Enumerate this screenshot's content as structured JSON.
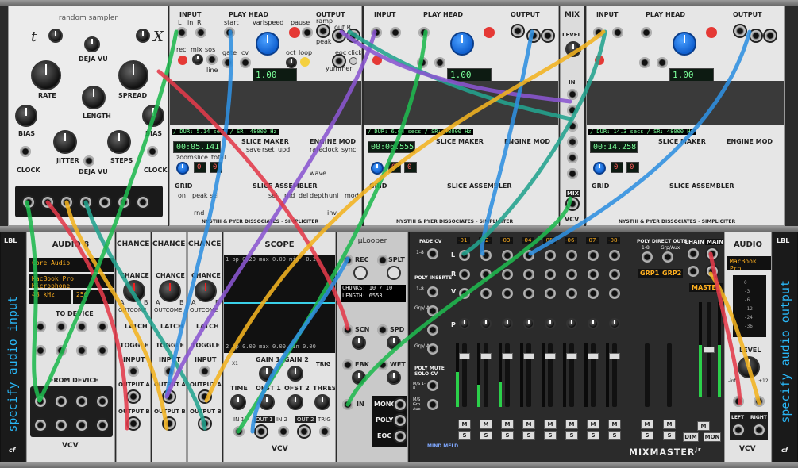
{
  "row1": {
    "sampler": {
      "title": "random sampler",
      "t_label": "t",
      "x_label": "X",
      "knobs": [
        "RATE",
        "SPREAD",
        "LENGTH",
        "BIAS",
        "BIAS",
        "DEJA VU"
      ],
      "labels": [
        "CLOCK",
        "JITTER",
        "DEJA VU",
        "STEPS",
        "CLOCK",
        "DEJA VU"
      ]
    },
    "simpliciter_1": {
      "headers": [
        "INPUT",
        "PLAY HEAD",
        "OUTPUT"
      ],
      "input_labels": [
        "L",
        "in",
        "R"
      ],
      "play_labels": [
        "start",
        "varispeed",
        "pause"
      ],
      "output_labels": [
        "ramp",
        "L out R"
      ],
      "row2": [
        "rec",
        "mix",
        "sos",
        "gate",
        "cv",
        "oct",
        "loop",
        "peak",
        "eoc",
        "click"
      ],
      "row3": [
        "line",
        "yummer"
      ],
      "display": "1.00",
      "dur": "/ DUR: 5.14 secs / SR: 48000 Hz",
      "time": "00:05.141",
      "slice_label": "SLICE MAKER",
      "slice_buttons": [
        "save",
        "rset",
        "upd"
      ],
      "engine_label": "ENGINE MOD",
      "engine_labels": [
        "rate",
        "clock",
        "sync",
        "wave"
      ],
      "zoom_labels": [
        "zoom",
        "slice",
        "total",
        "slice",
        "grid"
      ],
      "zoom_values": [
        "0",
        "0"
      ],
      "grid_label": "GRID",
      "grid_labels": [
        "on",
        "peak",
        "sel",
        "rnd"
      ],
      "assembler_label": "SLICE ASSEMBLER",
      "assembler_labels": [
        "sel",
        "rnd",
        "del",
        "depth",
        "uni",
        "mod",
        "inv"
      ],
      "footer": "NYSTHI & PYER DISSOCIATES - SIMPLICITER"
    },
    "simpliciter_2": {
      "display": "1.00",
      "dur": "/ DUR: 6.64 secs / SR: 48000 Hz",
      "time": "00:06.555",
      "zoom_values": [
        "0",
        "0"
      ],
      "footer": "NYSTHI & PYER DISSOCIATES - SIMPLICITER"
    },
    "mix": {
      "title": "MIX",
      "level": "LEVEL",
      "in": "IN",
      "mix": "MIX",
      "brand": "VCV"
    },
    "simpliciter_3": {
      "display": "1.00",
      "dur": "/ DUR: 14.3 secs / SR: 48000 Hz",
      "time": "00:14.258",
      "zoom_values": [
        "0",
        "0"
      ],
      "footer": "NYSTHI & PYER DISSOCIATES - SIMPLICITER"
    }
  },
  "row2": {
    "lbl_left": {
      "logo": "LBL",
      "text": "specify audio input",
      "cf": "cf"
    },
    "audio8": {
      "title": "AUDIO 8",
      "driver": "Core Audio",
      "device": "MacBook Pro Microphone",
      "rate": "48 kHz",
      "block": "256",
      "to_device": "TO DEVICE",
      "from_device": "FROM DEVICE",
      "nums_to": [
        "1",
        "2",
        "3",
        "4",
        "5",
        "6",
        "7",
        "8"
      ],
      "nums_from": [
        "1",
        "2",
        "3",
        "4",
        "5",
        "6",
        "7",
        "8"
      ],
      "brand": "VCV"
    },
    "chances": [
      {
        "title": "CHANCES",
        "chance": "CHANCE",
        "a": "A",
        "b": "B",
        "outcome": "OUTCOME",
        "latch": "LATCH",
        "toggle": "TOGGLE",
        "input": "INPUT",
        "out_a": "OUTPUT A",
        "out_b": "OUTPUT B"
      },
      {
        "title": "CHANCES",
        "chance": "CHANCE",
        "a": "A",
        "b": "B",
        "outcome": "OUTCOME",
        "latch": "LATCH",
        "toggle": "TOGGLE",
        "input": "INPUT",
        "out_a": "OUTPUT A",
        "out_b": "OUTPUT B"
      },
      {
        "title": "CHANCES",
        "chance": "CHANCE",
        "a": "A",
        "b": "B",
        "outcome": "OUTCOME",
        "latch": "LATCH",
        "toggle": "TOGGLE",
        "input": "INPUT",
        "out_a": "OUTPUT A",
        "out_b": "OUTPUT B"
      }
    ],
    "scope": {
      "title": "SCOPE",
      "top_readout": [
        "1",
        "pp",
        "0.20",
        "max",
        "0.09",
        "min",
        "-0.11"
      ],
      "bot_readout": [
        "2",
        "pp",
        "0.00",
        "max",
        "0.00",
        "min",
        "0.00"
      ],
      "labels": [
        "X1",
        "GAIN 1",
        "GAIN 2",
        "TRIG",
        "TIME",
        "OFST 1",
        "OFST 2",
        "THRES",
        "IN 1",
        "OUT 1",
        "IN 2",
        "OUT 2",
        "TRIG"
      ],
      "brand": "VCV"
    },
    "looper": {
      "title": "µLooper",
      "rec": "REC",
      "splt": "SPLT",
      "chunks": "CHUNKS: 10 / 10",
      "length": "LENGTH: 6553",
      "scn": "SCN",
      "spd": "SPD",
      "fbk": "FBK",
      "wet": "WET",
      "in": "IN",
      "mono": "MONO",
      "poly": "POLY",
      "eoc": "EOC"
    },
    "mixmaster": {
      "fade_cv": "FADE CV",
      "range1": "1-8",
      "poly_inserts": "POLY INSERTS",
      "grp_aux": "Grp/ Aux",
      "poly_mute": "POLY MUTE SOLO CV",
      "mute_labels": [
        "M/S 1-8",
        "M/S Grp Aux"
      ],
      "row_labels": [
        "L",
        "R",
        "V",
        "P"
      ],
      "tracks": [
        "-01-",
        "-02-",
        "-03-",
        "-04-",
        "-05-",
        "-06-",
        "-07-",
        "-08-"
      ],
      "levels": [
        0.55,
        0.35,
        0.4,
        0.0,
        0.0,
        0.0,
        0.0,
        0.0
      ],
      "direct_outs": "POLY DIRECT OUTS",
      "do_ranges": [
        "1-8",
        "Grp/Aux"
      ],
      "groups": [
        "GRP1",
        "GRP2"
      ],
      "chain": "CHAIN",
      "main": "MAIN",
      "master": "MASTER",
      "master_level": 0.55,
      "m": "M",
      "s": "S",
      "dim": "DIM",
      "mon": "MON",
      "brand_logo": "MIND MELD",
      "brand": "MIXMASTER",
      "brand_sup": "Jr"
    },
    "audio_out": {
      "title": "AUDIO",
      "device": "MacBook Pro",
      "db_labels": [
        "0",
        "-3",
        "-6",
        "-12",
        "-24",
        "-36"
      ],
      "level": "LEVEL",
      "level_min": "-inf",
      "level_max": "+12",
      "left": "LEFT",
      "right": "RIGHT",
      "brand": "VCV"
    },
    "lbl_right": {
      "logo": "LBL",
      "text": "specify audio output",
      "cf": "cf"
    }
  },
  "cable_colors": {
    "green": "#1fb84f",
    "blue": "#2f8fe0",
    "red": "#e33a4a",
    "yellow": "#f2b320",
    "purple": "#8a55d0",
    "teal": "#23a38e"
  }
}
